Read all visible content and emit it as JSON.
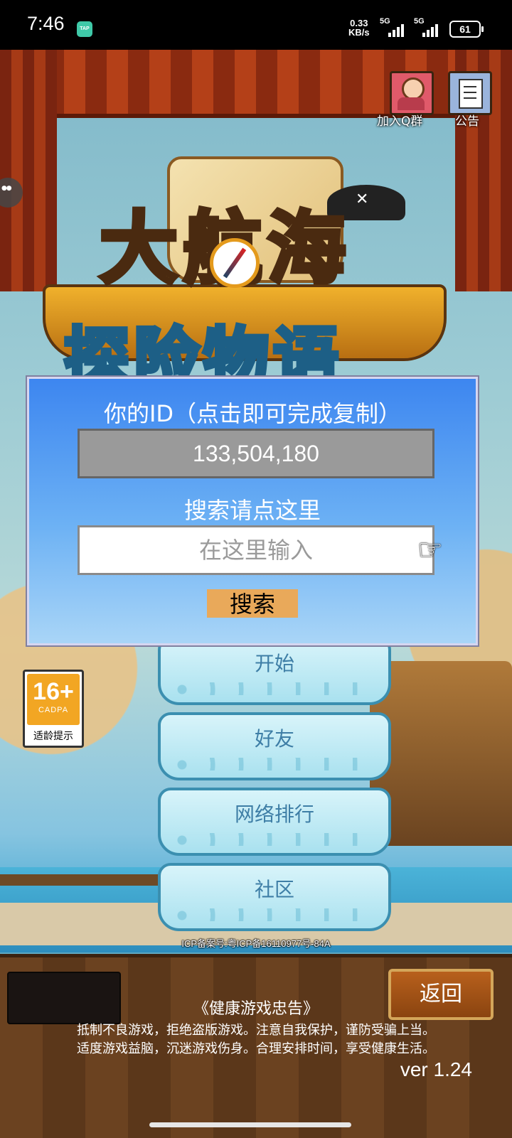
{
  "status_bar": {
    "time": "7:46",
    "tap_badge": "TAP",
    "net_speed_value": "0.33",
    "net_speed_unit": "KB/s",
    "signal1_label": "5G",
    "signal2_label": "5G",
    "battery": "61"
  },
  "top_icons": {
    "qq_group_label": "加入Q群",
    "notice_label": "公告"
  },
  "dialog": {
    "title": "你的ID（点击即可完成复制）",
    "user_id": "133,504,180",
    "search_hint": "搜索请点这里",
    "input_placeholder": "在这里输入",
    "search_button": "搜索"
  },
  "menu": {
    "start": "开始",
    "friends": "好友",
    "ranking": "网络排行",
    "community": "社区"
  },
  "rating": {
    "age": "16+",
    "org": "CADPA",
    "tip": "适龄提示"
  },
  "icp": "ICP备案号:粤ICP备16110977号-84A",
  "bottom": {
    "back_button": "返回",
    "health_title": "《健康游戏忠告》",
    "health_line1": "抵制不良游戏，拒绝盗版游戏。注意自我保护，谨防受骗上当。",
    "health_line2": "适度游戏益脑，沉迷游戏伤身。合理安排时间，享受健康生活。",
    "version": "ver 1.24"
  },
  "logo": {
    "line1": "大航海",
    "line2": "探险物语"
  },
  "icons": [
    "tap-icon",
    "signal-icon",
    "battery-icon",
    "qq-group-icon",
    "notice-icon",
    "pointer-hand-icon",
    "floating-assist-icon"
  ]
}
